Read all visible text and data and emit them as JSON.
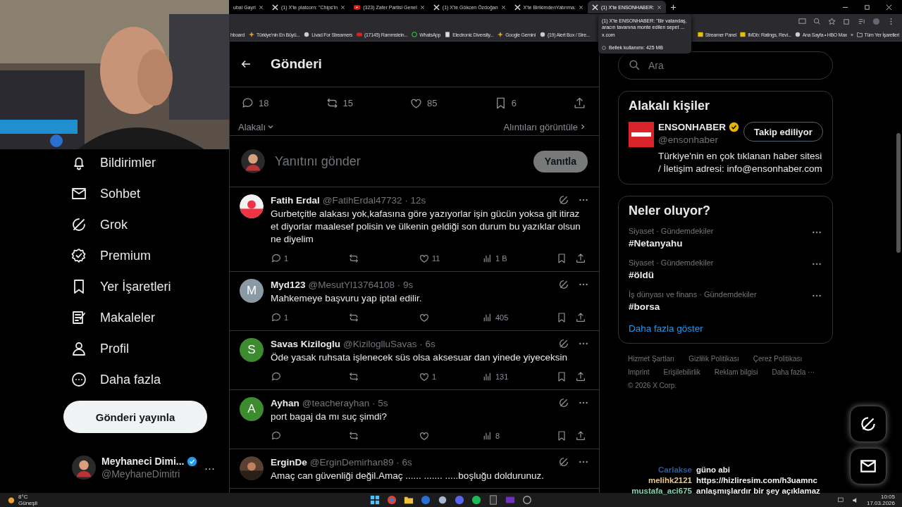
{
  "tabs": [
    {
      "title": "ubai Gayri",
      "selected": false,
      "kind": "plain"
    },
    {
      "title": "(1) X'te platcorn: \"Chips'in",
      "selected": false,
      "kind": "x"
    },
    {
      "title": "(323) Zafer Partisi Genel",
      "selected": false,
      "kind": "video"
    },
    {
      "title": "(1) X'te Gökcen Özdoğan",
      "selected": false,
      "kind": "x"
    },
    {
      "title": "X'te BirikimdenYatırıma:",
      "selected": false,
      "kind": "x"
    },
    {
      "title": "(1) X'te ENSONHABER:",
      "selected": true,
      "kind": "x"
    }
  ],
  "tab_tooltip": {
    "title": "(1) X'te ENSONHABER: \"Bir vatandaş, aracın tavanına monte edilen sepet ...",
    "domain": "x.com",
    "memory": "Bellek kullanımı: 425 MB"
  },
  "bookmarks": [
    {
      "label": "hboard",
      "kind": "none"
    },
    {
      "label": "Türkiye'nin En Büyü...",
      "kind": "star"
    },
    {
      "label": "Livad For Streamers",
      "kind": "circle"
    },
    {
      "label": "(17145) Rammstein...",
      "kind": "video"
    },
    {
      "label": "WhatsApp",
      "kind": "chat"
    },
    {
      "label": "Electronic Diversity...",
      "kind": "page"
    },
    {
      "label": "Google Gemini",
      "kind": "star"
    },
    {
      "label": "(19) Alert Box / Stre...",
      "kind": "circle"
    }
  ],
  "bookmarks_right": [
    {
      "label": "Streamer Panel",
      "kind": "page"
    },
    {
      "label": "IMDb: Ratings, Revi...",
      "kind": "page"
    },
    {
      "label": "Ana Sayfa • HBO Max",
      "kind": "circle"
    }
  ],
  "bookmarks_more": "»",
  "all_bookmarks": "Tüm Yer İşaretleri",
  "nav": [
    {
      "label": "Bildirimler",
      "kind": "bell"
    },
    {
      "label": "Sohbet",
      "kind": "mail"
    },
    {
      "label": "Grok",
      "kind": "grok"
    },
    {
      "label": "Premium",
      "kind": "badge"
    },
    {
      "label": "Yer İşaretleri",
      "kind": "bookmark"
    },
    {
      "label": "Makaleler",
      "kind": "article"
    },
    {
      "label": "Profil",
      "kind": "person"
    },
    {
      "label": "Daha fazla",
      "kind": "more"
    }
  ],
  "post_button": "Gönderi yayınla",
  "account": {
    "name": "Meyhaneci Dimi...",
    "handle": "@MeyhaneDimitri",
    "verified": true,
    "more": "···"
  },
  "header": {
    "title": "Gönderi"
  },
  "stats": [
    {
      "kind": "reply",
      "count": "18"
    },
    {
      "kind": "repost",
      "count": "15"
    },
    {
      "kind": "like",
      "count": "85"
    },
    {
      "kind": "bookmark",
      "count": "6"
    },
    {
      "kind": "share"
    }
  ],
  "sort": {
    "label": "Alakalı",
    "quotes": "Alıntıları görüntüle"
  },
  "composer": {
    "placeholder": "Yanıtını gönder",
    "button": "Yanıtla",
    "disabled": true
  },
  "replies": [
    {
      "name": "Fatih Erdal",
      "handle": "@FatihErdal47732 · 12s",
      "text": "Gurbetçitle alakası yok,kafasına göre yazıyorlar işin gücün yoksa git itiraz et diyorlar maalesef polisin ve ülkenin geldiği son durum bu yazıklar olsun ne diyelim",
      "counts": {
        "reply": "1",
        "like": "11",
        "views": "1 B"
      }
    },
    {
      "name": "Myd123",
      "handle": "@MesutYl13764108 · 9s",
      "text": "Mahkemeye başvuru yap iptal edilir.",
      "avatar": {
        "kind": "letter",
        "letter": "M",
        "color": "#8a9aa4"
      },
      "counts": {
        "reply": "1",
        "views": "405"
      }
    },
    {
      "name": "Savas Kiziloglu",
      "handle": "@KiziloglluSavas · 6s",
      "text": "Öde yasak ruhsata işlenecek süs olsa aksesuar dan yinede yiyeceksin",
      "avatar": {
        "kind": "letter",
        "letter": "S",
        "color": "#3d8b2f"
      },
      "counts": {
        "like": "1",
        "views": "131"
      }
    },
    {
      "name": "Ayhan",
      "handle": "@teacherayhan · 5s",
      "text": "port bagaj da mı suç şimdi?",
      "avatar": {
        "kind": "letter",
        "letter": "A",
        "color": "#3d8b2f"
      },
      "counts": {
        "views": "8"
      }
    },
    {
      "name": "ErginDe",
      "handle": "@ErginDemirhan89 · 6s",
      "text": "Amaç can güvenliği değil.Amaç ...... ....... .....boşluğu doldurunuz."
    }
  ],
  "search": {
    "placeholder": "Ara"
  },
  "people": {
    "title": "Alakalı kişiler",
    "name": "ENSONHABER",
    "verified": true,
    "handle": "@ensonhaber",
    "button": "Takip ediliyor",
    "bio": "Türkiye'nin en çok tıklanan haber sitesi / İletişim adresi: info@ensonhaber.com"
  },
  "trends": {
    "title": "Neler oluyor?",
    "items": [
      {
        "context": "Siyaset · Gündemdekiler",
        "tag": "#Netanyahu"
      },
      {
        "context": "Siyaset · Gündemdekiler",
        "tag": "#öldü"
      },
      {
        "context": "İş dünyası ve finans · Gündemdekiler",
        "tag": "#borsa"
      }
    ],
    "more": "Daha fazla göster"
  },
  "footer": [
    "Hizmet Şartları",
    "Gizlilik Politikası",
    "Çerez Politikası",
    "Imprint",
    "Erişilebilirlik",
    "Reklam bilgisi",
    "Daha fazla ···"
  ],
  "copyright": "© 2026 X Corp.",
  "chat": [
    {
      "user": "Carlakse",
      "message": "güno abi",
      "color": "#2e5a9a"
    },
    {
      "user": "melihk2121",
      "message": "https://hizliresim.com/h3uamnc",
      "color": "#e8c88a"
    },
    {
      "user": "mustafa_aci675",
      "message": "anlaşmışlardır bir şey açıklamaz",
      "color": "#7fd6b0"
    }
  ],
  "taskbar": {
    "temp": "8°C",
    "weather": "Güneşli",
    "time": "10:05",
    "date": "17.03.2026"
  }
}
